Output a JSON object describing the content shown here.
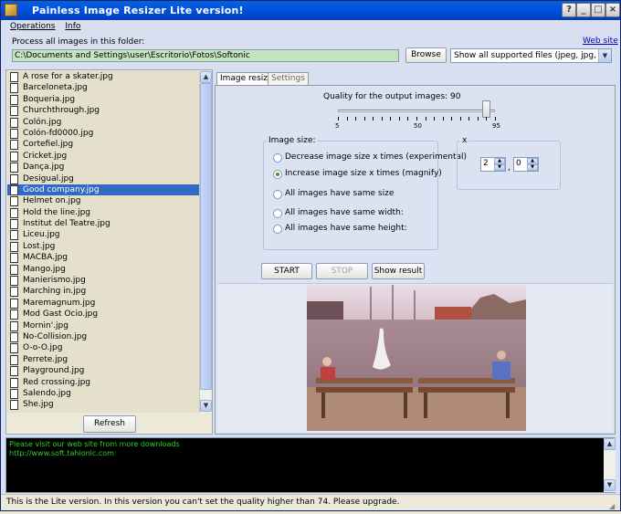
{
  "window": {
    "title": "Painless Image Resizer    Lite version!"
  },
  "menu": [
    "Operations",
    "Info"
  ],
  "folder": {
    "label": "Process all images in this folder:",
    "path": "C:\\Documents and Settings\\user\\Escritorio\\Fotos\\Softonic",
    "browse_label": "Browse",
    "filter": "Show all supported files (jpeg, jpg, gif, png,",
    "website_link": "Web site"
  },
  "file_list": {
    "items": [
      "A rose for a skater.jpg",
      "Barceloneta.jpg",
      "Boqueria.jpg",
      "Churchthrough.jpg",
      "Colón.jpg",
      "Colón-fd0000.jpg",
      "Cortefiel.jpg",
      "Cricket.jpg",
      "Dança.jpg",
      "Desigual.jpg",
      "Good company.jpg",
      "Helmet on.jpg",
      "Hold the line.jpg",
      "Institut del Teatre.jpg",
      "Liceu.jpg",
      "Lost.jpg",
      "MACBA.jpg",
      "Mango.jpg",
      "Manierismo.jpg",
      "Marching in.jpg",
      "Maremagnum.jpg",
      "Mod Gast Ocio.jpg",
      "Mornin'.jpg",
      "No-Collision.jpg",
      "O-o-O.jpg",
      "Perrete.jpg",
      "Playground.jpg",
      "Red crossing.jpg",
      "Salendo.jpg",
      "She.jpg"
    ],
    "selected": "Good company.jpg",
    "refresh_label": "Refresh"
  },
  "tabs": [
    "Image resizer",
    "Settings"
  ],
  "quality": {
    "label": "Quality for the output images: 90",
    "value": 90,
    "min": 5,
    "max": 95,
    "tick_labels": [
      "5",
      "50",
      "95"
    ]
  },
  "image_size": {
    "title": "Image size:",
    "options": [
      "Decrease image size x times (experimental)",
      "Increase image size x times (magnify)",
      "All images have same size",
      "All images have same width:",
      "All images have same height:"
    ],
    "selected_index": 1
  },
  "multiplier": {
    "title": "x",
    "integer": "2",
    "separator": ",",
    "decimal": "0"
  },
  "actions": {
    "start": "START",
    "stop": "STOP",
    "show_result": "Show result"
  },
  "console": {
    "lines": [
      "Please visit our web site from more downloads",
      "http://www.soft.tahionic.com"
    ],
    "text_color": "#2ed02e"
  },
  "status": "This is the Lite version. In this version you can't set the quality higher than 74. Please upgrade."
}
